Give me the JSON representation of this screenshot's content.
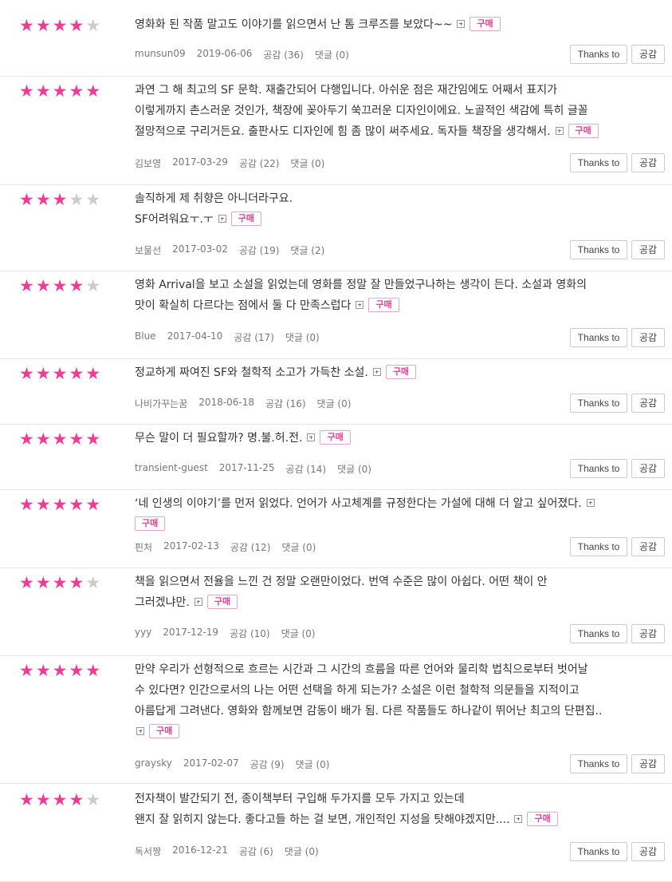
{
  "colors": {
    "star_on": "#ef3c96",
    "star_off": "#cccccc",
    "buy": "#ef3c96"
  },
  "thanks_label": "Thanks to",
  "like_label": "공감",
  "buy_label": "구매",
  "reviews": [
    {
      "rating": 4,
      "lines": [
        "영화화 된 작품 말고도 이야기를 읽으면서 난 톰 크루즈를 보았다~~"
      ],
      "user": "munsun09",
      "date": "2019-06-06",
      "likes": "공감 (36)",
      "comments": "댓글 (0)"
    },
    {
      "rating": 5,
      "lines": [
        "과연 그 해 최고의 SF 문학. 재출간되어 다행입니다. 아쉬운 점은 재간임에도 어째서 표지가",
        "이렇게까지 촌스러운 것인가, 책장에 꽂아두기 쑥끄러운 디자인이에요. 노골적인 색감에 특히 글꼴",
        "절망적으로 구리거든요. 출판사도 디자인에 힘 좀 많이 써주세요. 독자들 책장을 생각해서."
      ],
      "user": "김보영",
      "date": "2017-03-29",
      "likes": "공감 (22)",
      "comments": "댓글 (0)"
    },
    {
      "rating": 3,
      "lines": [
        "솔직하게 제 취향은 아니더라구요.",
        "SF어려워요ㅜ.ㅜ"
      ],
      "user": "보물선",
      "date": "2017-03-02",
      "likes": "공감 (19)",
      "comments": "댓글 (2)"
    },
    {
      "rating": 4,
      "lines": [
        "영화 Arrival을 보고 소설을 읽었는데 영화를 정말 잘 만들었구나하는 생각이 든다. 소설과 영화의",
        "맛이 확실히 다르다는 점에서 둘 다 만족스럽다"
      ],
      "user": "Blue",
      "date": "2017-04-10",
      "likes": "공감 (17)",
      "comments": "댓글 (0)"
    },
    {
      "rating": 5,
      "lines": [
        "정교하게 짜여진 SF와 철학적 소고가 가득찬 소설."
      ],
      "user": "나비가꾸는꿈",
      "date": "2018-06-18",
      "likes": "공감 (16)",
      "comments": "댓글 (0)"
    },
    {
      "rating": 5,
      "lines": [
        "무슨 말이 더 필요할까? 명.불.허.전."
      ],
      "user": "transient-guest",
      "date": "2017-11-25",
      "likes": "공감 (14)",
      "comments": "댓글 (0)"
    },
    {
      "rating": 5,
      "lines": [
        "‘네 인생의 이야기’를 먼저 읽었다. 언어가 사고체계를 규정한다는 가설에 대해 더 알고 싶어졌다."
      ],
      "user": "핀처",
      "date": "2017-02-13",
      "likes": "공감 (12)",
      "comments": "댓글 (0)"
    },
    {
      "rating": 4,
      "lines": [
        "책을 읽으면서 전율을 느낀 건 정말 오랜만이었다. 번역 수준은 많이 아쉽다. 어떤 책이 안",
        "그러겠냐만."
      ],
      "user": "yyy",
      "date": "2017-12-19",
      "likes": "공감 (10)",
      "comments": "댓글 (0)"
    },
    {
      "rating": 5,
      "lines": [
        "만약 우리가 선형적으로 흐르는 시간과 그 시간의 흐름을 따른 언어와 물리학 법칙으로부터 벗어날",
        "수 있다면? 인간으로서의 나는 어떤 선택을 하게 되는가? 소설은 이런 철학적 의문들을 지적이고",
        "아름답게 그려낸다. 영화와 함께보면 감동이 배가 됨. 다른 작품들도 하나같이 뛰어난 최고의 단편집.."
      ],
      "user": "graysky",
      "date": "2017-02-07",
      "likes": "공감 (9)",
      "comments": "댓글 (0)"
    },
    {
      "rating": 4,
      "lines": [
        "전자책이 발간되기 전, 종이책부터 구입해 두가지를 모두 가지고 있는데",
        "왠지 잘 읽히지 않는다. 좋다고들 하는 걸 보면, 개인적인 지성을 탓해야겠지만...."
      ],
      "user": "독서짱",
      "date": "2016-12-21",
      "likes": "공감 (6)",
      "comments": "댓글 (0)"
    }
  ]
}
